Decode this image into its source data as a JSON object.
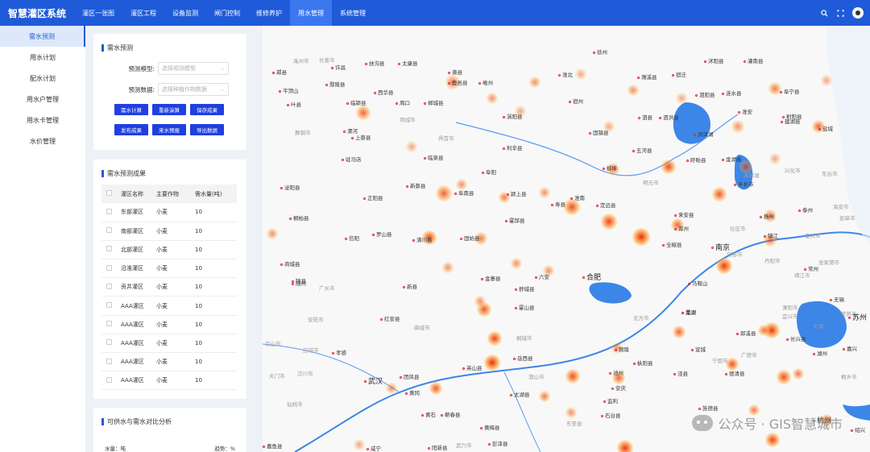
{
  "app": {
    "title": "智慧灌区系统"
  },
  "nav": [
    "灌区一张图",
    "灌区工程",
    "设备监测",
    "闸门控制",
    "维修养护",
    "用水管理",
    "系统管理"
  ],
  "nav_active": 5,
  "sidebar": [
    "需水预测",
    "用水计划",
    "配水计划",
    "用水户管理",
    "用水卡管理",
    "水价管理"
  ],
  "forecast_panel": {
    "title": "需水预测",
    "model_label": "预测模型:",
    "model_placeholder": "选择预测模型",
    "data_label": "预测数据:",
    "data_placeholder": "选择种植作物数据",
    "buttons_row1": [
      "需水计算",
      "重新演算",
      "保存成果"
    ],
    "buttons_row2": [
      "发布成果",
      "来水预报",
      "导出数据"
    ]
  },
  "results_panel": {
    "title": "需水预测成果",
    "headers": [
      "灌区名称",
      "主要作物",
      "需水量(吨)"
    ],
    "rows": [
      [
        "东部灌区",
        "小麦",
        "10"
      ],
      [
        "南部灌区",
        "小麦",
        "10"
      ],
      [
        "北部灌区",
        "小麦",
        "10"
      ],
      [
        "沿淮灌区",
        "小麦",
        "10"
      ],
      [
        "贡井灌区",
        "小麦",
        "10"
      ],
      [
        "AAA灌区",
        "小麦",
        "10"
      ],
      [
        "AAA灌区",
        "小麦",
        "10"
      ],
      [
        "AAA灌区",
        "小麦",
        "10"
      ],
      [
        "AAA灌区",
        "小麦",
        "10"
      ],
      [
        "AAA灌区",
        "小麦",
        "10"
      ]
    ]
  },
  "analysis_panel": {
    "title": "可供水与需水对比分析",
    "left_label": "水量：吨",
    "right_label": "趋势：%"
  },
  "map": {
    "cities": [
      {
        "n": "长葛市",
        "g": 1
      },
      {
        "n": "禹州市",
        "g": 1
      },
      {
        "n": "许昌"
      },
      {
        "n": "扶沟县"
      },
      {
        "n": "太康县"
      },
      {
        "n": "萧县"
      },
      {
        "n": "徐州"
      },
      {
        "n": "沭阳县"
      },
      {
        "n": "灌南县"
      },
      {
        "n": "郏县"
      },
      {
        "n": "鄢陵县"
      },
      {
        "n": "西华县"
      },
      {
        "n": "鹿邑县"
      },
      {
        "n": "亳州"
      },
      {
        "n": "淮北"
      },
      {
        "n": "濉溪县"
      },
      {
        "n": "宿迁"
      },
      {
        "n": "泗阳县"
      },
      {
        "n": "涟水县"
      },
      {
        "n": "阜宁县"
      },
      {
        "n": "平顶山"
      },
      {
        "n": "临颍县"
      },
      {
        "n": "周口"
      },
      {
        "n": "郸城县"
      },
      {
        "n": "宿州"
      },
      {
        "n": "泗县"
      },
      {
        "n": "泗洪县"
      },
      {
        "n": "淮安"
      },
      {
        "n": "射阳县"
      },
      {
        "n": "叶县"
      },
      {
        "n": "漯河"
      },
      {
        "n": "项城市",
        "g": 1
      },
      {
        "n": "涡阳县"
      },
      {
        "n": "固镇县"
      },
      {
        "n": "洪泽湖"
      },
      {
        "n": "建湖县"
      },
      {
        "n": "盐城"
      },
      {
        "n": "舞钢市",
        "g": 1
      },
      {
        "n": "界首市",
        "g": 1
      },
      {
        "n": "利辛县"
      },
      {
        "n": "五河县"
      },
      {
        "n": "盱眙县"
      },
      {
        "n": "金湖县"
      },
      {
        "n": "上蔡县"
      },
      {
        "n": "临泉县"
      },
      {
        "n": "阜阳"
      },
      {
        "n": "蚌埠"
      },
      {
        "n": "兴化市",
        "g": 1
      },
      {
        "n": "东台市",
        "g": 1
      },
      {
        "n": "驻马店"
      },
      {
        "n": "新蔡县"
      },
      {
        "n": "颍上县"
      },
      {
        "n": "淮南"
      },
      {
        "n": "明光市",
        "g": 1
      },
      {
        "n": "天长市"
      },
      {
        "n": "高邮湖",
        "g": 1
      },
      {
        "n": "泌阳县"
      },
      {
        "n": "正阳县"
      },
      {
        "n": "阜南县"
      },
      {
        "n": "寿县"
      },
      {
        "n": "定远县"
      },
      {
        "n": "海安市",
        "g": 1
      },
      {
        "n": "如皋市",
        "g": 1
      },
      {
        "n": "泰州"
      },
      {
        "n": "桐柏县"
      },
      {
        "n": "罗山县"
      },
      {
        "n": "霍邱县"
      },
      {
        "n": "来安县"
      },
      {
        "n": "扬州"
      },
      {
        "n": "信阳"
      },
      {
        "n": "潢川县"
      },
      {
        "n": "固始县"
      },
      {
        "n": "全椒县"
      },
      {
        "n": "滁州"
      },
      {
        "n": "仪征市",
        "g": 1
      },
      {
        "n": "镇江"
      },
      {
        "n": "泰兴市",
        "g": 1
      },
      {
        "n": "商城县"
      },
      {
        "n": "南京"
      },
      {
        "n": "句容市",
        "g": 1
      },
      {
        "n": "丹阳市",
        "g": 1
      },
      {
        "n": "常州"
      },
      {
        "n": "靖江市",
        "g": 1
      },
      {
        "n": "张家港市",
        "g": 1
      },
      {
        "n": "随县"
      },
      {
        "n": "随州"
      },
      {
        "n": "六安"
      },
      {
        "n": "合肥"
      },
      {
        "n": "金寨县"
      },
      {
        "n": "舒城县"
      },
      {
        "n": "马鞍山"
      },
      {
        "n": "溧阳市",
        "g": 1
      },
      {
        "n": "宜兴市",
        "g": 1
      },
      {
        "n": "无锡"
      },
      {
        "n": "常熟市",
        "g": 1
      },
      {
        "n": "广水市",
        "g": 1
      },
      {
        "n": "新县"
      },
      {
        "n": "霍山县"
      },
      {
        "n": "巢湖"
      },
      {
        "n": "芜湖"
      },
      {
        "n": "苏州"
      },
      {
        "n": "太湖",
        "g": 1
      },
      {
        "n": "安陆市",
        "g": 1
      },
      {
        "n": "红安县"
      },
      {
        "n": "麻城市",
        "g": 1
      },
      {
        "n": "无为市",
        "g": 1
      },
      {
        "n": "郎溪县"
      },
      {
        "n": "长兴县"
      },
      {
        "n": "湖州"
      },
      {
        "n": "京山市",
        "g": 1
      },
      {
        "n": "应城市",
        "g": 1
      },
      {
        "n": "孝感"
      },
      {
        "n": "桐城市",
        "g": 1
      },
      {
        "n": "铜陵"
      },
      {
        "n": "宣城"
      },
      {
        "n": "广德市",
        "g": 1
      },
      {
        "n": "嘉兴"
      },
      {
        "n": "天门市",
        "g": 1
      },
      {
        "n": "汉川市",
        "g": 1
      },
      {
        "n": "武汉"
      },
      {
        "n": "团风县"
      },
      {
        "n": "英山县"
      },
      {
        "n": "岳西县"
      },
      {
        "n": "潜山市",
        "g": 1
      },
      {
        "n": "枞阳县"
      },
      {
        "n": "池州"
      },
      {
        "n": "泾县"
      },
      {
        "n": "宁国市",
        "g": 1
      },
      {
        "n": "德清县"
      },
      {
        "n": "桐乡市",
        "g": 1
      },
      {
        "n": "仙桃市",
        "g": 1
      },
      {
        "n": "黄冈"
      },
      {
        "n": "太湖县"
      },
      {
        "n": "安庆"
      },
      {
        "n": "旌德县"
      },
      {
        "n": "杭州"
      },
      {
        "n": "绍兴"
      },
      {
        "n": "黄石"
      },
      {
        "n": "蕲春县"
      },
      {
        "n": "东至县",
        "g": 1
      },
      {
        "n": "石台县"
      },
      {
        "n": "嘉鱼县"
      },
      {
        "n": "咸宁"
      },
      {
        "n": "黄梅县"
      },
      {
        "n": "阳新县"
      },
      {
        "n": "彭泽县"
      },
      {
        "n": "武穴市",
        "g": 1
      },
      {
        "n": "监利"
      }
    ]
  },
  "watermark": "公众号 · GIS智慧城市"
}
